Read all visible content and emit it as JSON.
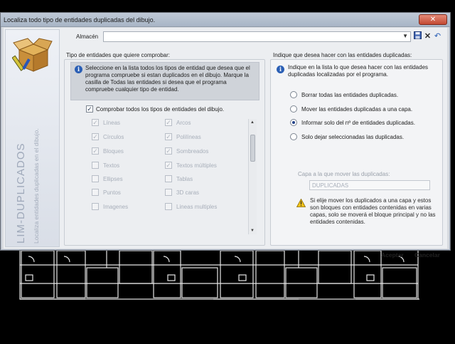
{
  "window": {
    "title": "Localiza todo tipo de entidades duplicadas del dibujo."
  },
  "banner": {
    "title": "LIM-DUPLICADOS",
    "subtitle": "Localiza entidades duplicadas en el dibujo."
  },
  "almacen": {
    "label": "Almacén",
    "value": ""
  },
  "left_group": {
    "title": "Tipo de entidades que quiere comprobar:",
    "info": "Seleccione en la lista todos los tipos de entidad que desea que el programa compruebe si estan duplicados en el dibujo. Marque la casilla de Todas las entidades si desea que el programa compruebe cualquier tipo de entidad.",
    "check_all_label": "Comprobar todos los tipos de entidades del dibujo.",
    "check_all_checked": true,
    "items": [
      {
        "label": "Líneas",
        "checked": true
      },
      {
        "label": "Arcos",
        "checked": true
      },
      {
        "label": "Círculos",
        "checked": true
      },
      {
        "label": "Polilíneas",
        "checked": true
      },
      {
        "label": "Bloques",
        "checked": true
      },
      {
        "label": "Sombreados",
        "checked": true
      },
      {
        "label": "Textos",
        "checked": false
      },
      {
        "label": "Textos múltiples",
        "checked": true
      },
      {
        "label": "Ellipses",
        "checked": false
      },
      {
        "label": "Tablas",
        "checked": false
      },
      {
        "label": "Puntos",
        "checked": false
      },
      {
        "label": "3D caras",
        "checked": false
      },
      {
        "label": "Imagenes",
        "checked": false
      },
      {
        "label": "Lineas multiples",
        "checked": false
      }
    ]
  },
  "right_group": {
    "title": "Indique que desea hacer con las entidades duplicadas:",
    "info": "Indique en la lista lo que desea hacer con las entidades duplicadas localizadas por el programa.",
    "options": [
      {
        "label": "Borrar todas las entidades duplicadas.",
        "selected": false
      },
      {
        "label": "Mover las entidades duplicadas a una capa.",
        "selected": false
      },
      {
        "label": "Informar solo del nº de entidades duplicadas.",
        "selected": true
      },
      {
        "label": "Solo dejar seleccionadas las duplicadas.",
        "selected": false
      }
    ],
    "capa_label": "Capa a la que mover las duplicadas:",
    "capa_value": "DUPLICADAS",
    "warning": "Si elije mover los duplicados a una capa y estos son bloques con entidades contenidas en varias capas, solo se moverá el bloque principal y no las entidades contenidas."
  },
  "buttons": {
    "accept": "Aceptar",
    "cancel": "Cancelar"
  },
  "colors": {
    "title_bar": "#b4bfcd",
    "close": "#c34a33",
    "accent": "#2b5fb5"
  }
}
